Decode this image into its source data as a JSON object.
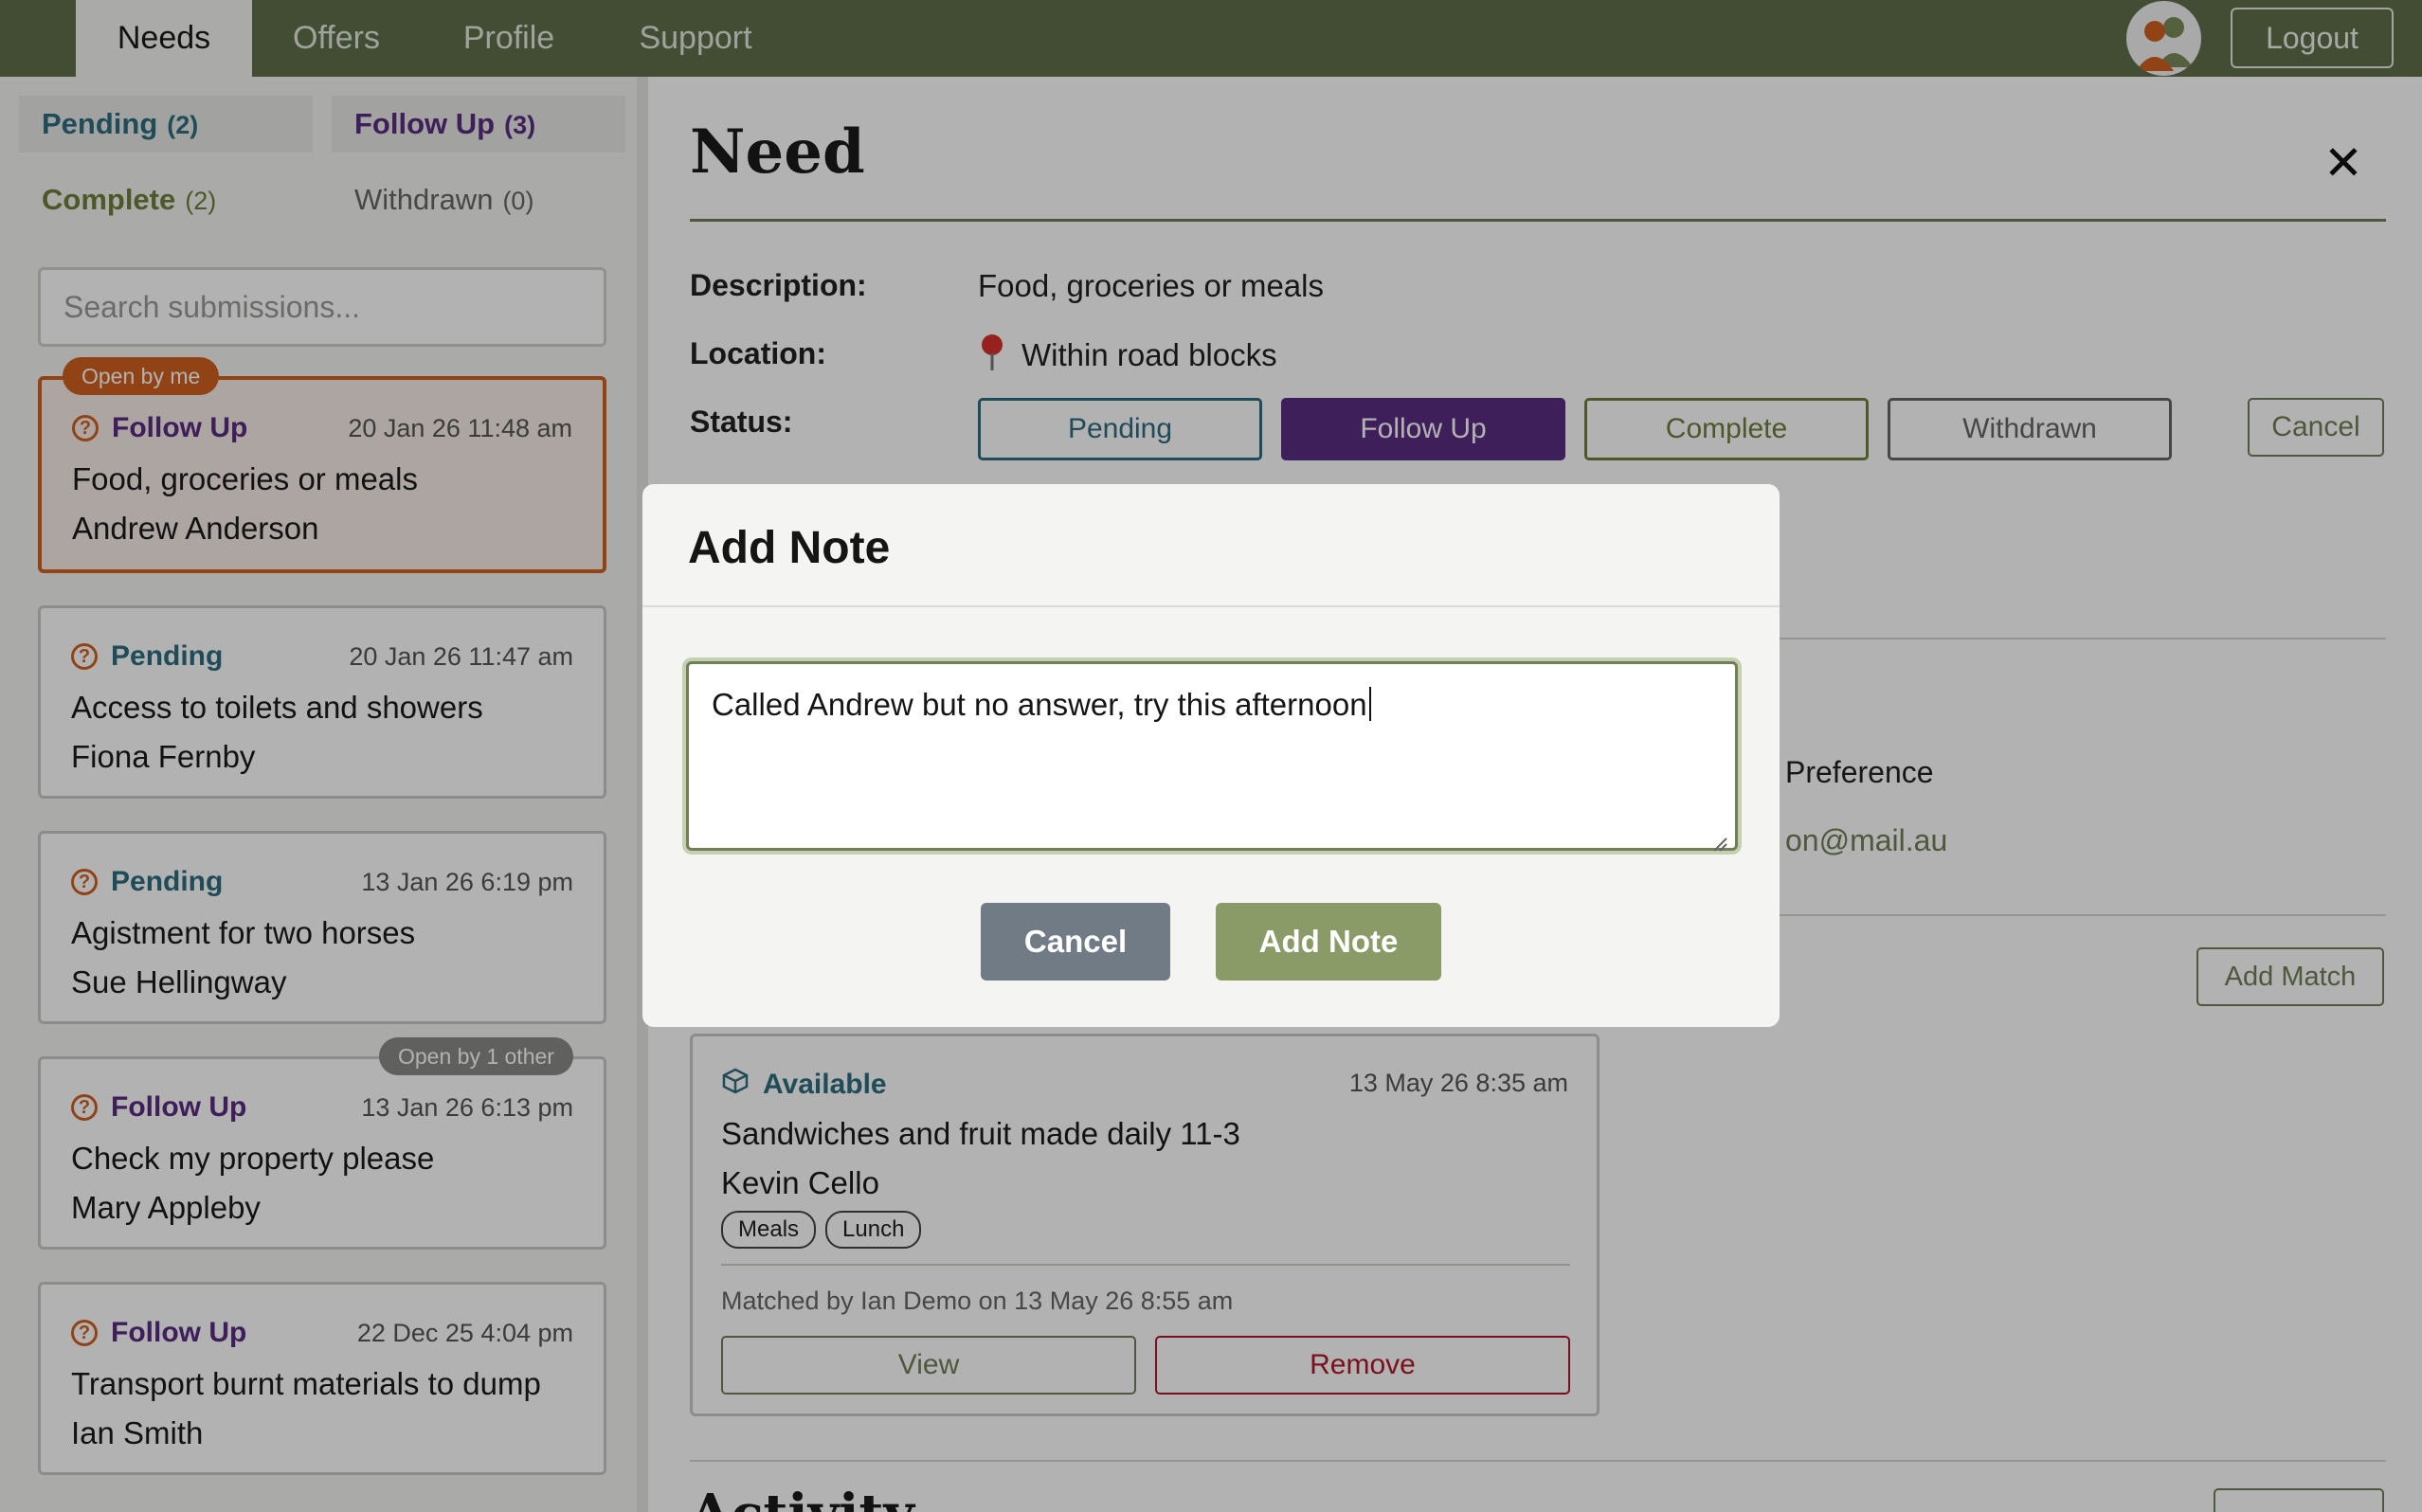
{
  "nav": {
    "tabs": [
      {
        "label": "Needs",
        "active": true
      },
      {
        "label": "Offers",
        "active": false
      },
      {
        "label": "Profile",
        "active": false
      },
      {
        "label": "Support",
        "active": false
      }
    ],
    "logout_label": "Logout"
  },
  "sidebar": {
    "filters": [
      {
        "label": "Pending",
        "count": "(2)",
        "color": "#2d6e7e"
      },
      {
        "label": "Follow Up",
        "count": "(3)",
        "color": "#5a2d82"
      },
      {
        "label": "Complete",
        "count": "(2)",
        "color": "#6f7f3c"
      },
      {
        "label": "Withdrawn",
        "count": "(0)",
        "color": "#666666"
      }
    ],
    "search_placeholder": "Search submissions...",
    "cards": [
      {
        "status": "Follow Up",
        "date": "20 Jan 26 11:48 am",
        "title": "Food, groceries or meals",
        "name": "Andrew Anderson",
        "badge": "Open by me"
      },
      {
        "status": "Pending",
        "date": "20 Jan 26 11:47 am",
        "title": "Access to toilets and showers",
        "name": "Fiona Fernby"
      },
      {
        "status": "Pending",
        "date": "13 Jan 26 6:19 pm",
        "title": "Agistment for two horses",
        "name": "Sue Hellingway"
      },
      {
        "status": "Follow Up",
        "date": "13 Jan 26 6:13 pm",
        "title": "Check my property please",
        "name": "Mary Appleby",
        "badge": "Open by 1 other"
      },
      {
        "status": "Follow Up",
        "date": "22 Dec 25 4:04 pm",
        "title": "Transport burnt materials to dump",
        "name": "Ian Smith"
      }
    ]
  },
  "detail": {
    "title": "Need",
    "description_label": "Description:",
    "description": "Food, groceries or meals",
    "location_label": "Location:",
    "location": "Within road blocks",
    "status_label": "Status:",
    "status_buttons": [
      "Pending",
      "Follow Up",
      "Complete",
      "Withdrawn"
    ],
    "cancel_label": "Cancel",
    "peek_preference": "Preference",
    "peek_email": "on@mail.au",
    "add_match_label": "Add Match",
    "offer": {
      "status": "Available",
      "date": "13 May 26 8:35 am",
      "title": "Sandwiches and fruit made daily 11-3",
      "name": "Kevin Cello",
      "tags": [
        "Meals",
        "Lunch"
      ],
      "matched": "Matched by Ian Demo on 13 May 26 8:55 am",
      "view_label": "View",
      "remove_label": "Remove"
    },
    "activity_title": "Activity"
  },
  "modal": {
    "title": "Add Note",
    "note_text": "Called Andrew but no answer, try this afternoon",
    "cancel_label": "Cancel",
    "submit_label": "Add Note"
  },
  "colors": {
    "nav_bg": "#5f6f4a",
    "pending": "#2d6e7e",
    "follow_up": "#5a2d82",
    "complete": "#6f7f3c",
    "accent_orange": "#d2601f",
    "primary_button": "#8a9b68",
    "secondary_button": "#717b85",
    "remove_red": "#b0182a"
  }
}
